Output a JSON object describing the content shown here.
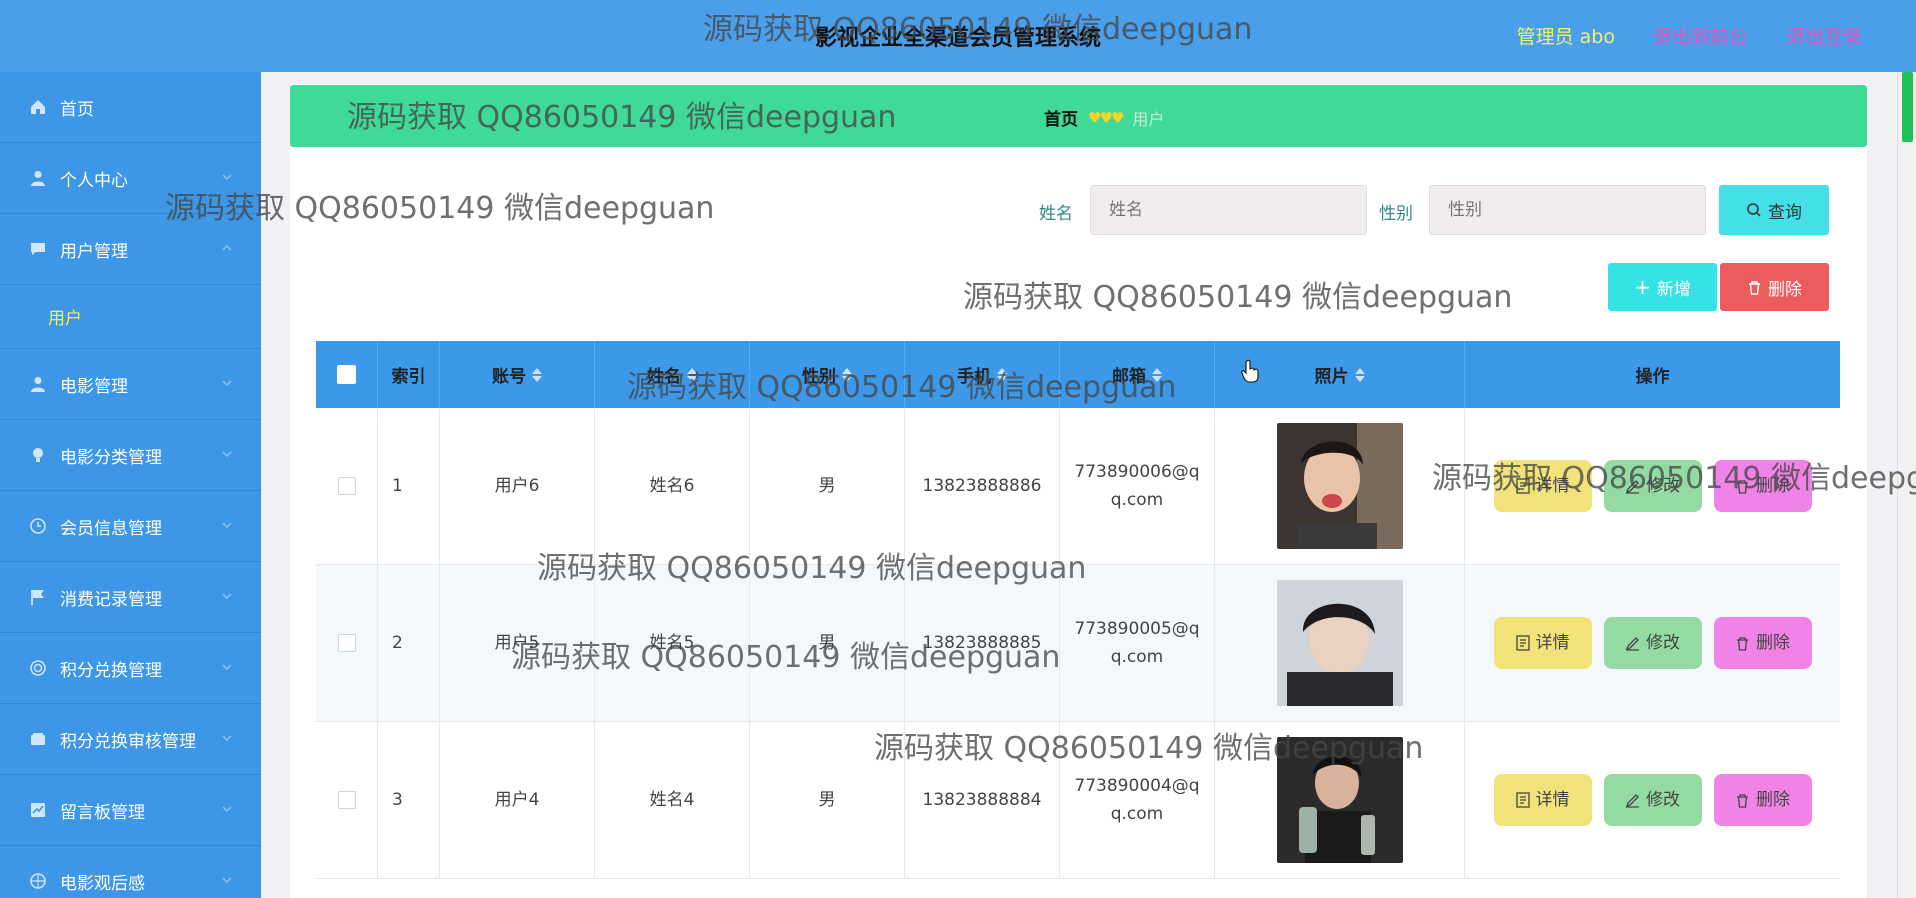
{
  "header": {
    "title": "影视企业全渠道会员管理系统",
    "admin_label": "管理员 abo",
    "back_front": "退出到前台",
    "logout": "退出登录"
  },
  "sidebar": {
    "items": [
      {
        "label": "首页",
        "icon": "home-icon"
      },
      {
        "label": "个人中心",
        "icon": "user-icon"
      },
      {
        "label": "用户管理",
        "icon": "chat-icon",
        "expanded": true
      },
      {
        "label": "电影管理",
        "icon": "user-icon"
      },
      {
        "label": "电影分类管理",
        "icon": "bulb-icon"
      },
      {
        "label": "会员信息管理",
        "icon": "clock-icon"
      },
      {
        "label": "消费记录管理",
        "icon": "flag-icon"
      },
      {
        "label": "积分兑换管理",
        "icon": "circle-icon"
      },
      {
        "label": "积分兑换审核管理",
        "icon": "wallet-icon"
      },
      {
        "label": "留言板管理",
        "icon": "chart-icon"
      },
      {
        "label": "电影观后感",
        "icon": "target-icon"
      }
    ],
    "sub_user": "用户"
  },
  "breadcrumb": {
    "home": "首页",
    "hearts": "♥♥♥",
    "current": "用户"
  },
  "search": {
    "name_label": "姓名",
    "name_placeholder": "姓名",
    "gender_label": "性别",
    "gender_placeholder": "性别",
    "query_label": "查询"
  },
  "actions": {
    "add_label": "新增",
    "delete_label": "删除"
  },
  "table": {
    "headers": [
      "索引",
      "账号",
      "姓名",
      "性别",
      "手机",
      "邮箱",
      "照片",
      "操作"
    ],
    "rows": [
      {
        "index": "1",
        "account": "用户6",
        "name": "姓名6",
        "gender": "男",
        "phone": "13823888886",
        "email": "773890006@qq.com"
      },
      {
        "index": "2",
        "account": "用户5",
        "name": "姓名5",
        "gender": "男",
        "phone": "13823888885",
        "email": "773890005@qq.com"
      },
      {
        "index": "3",
        "account": "用户4",
        "name": "姓名4",
        "gender": "男",
        "phone": "13823888884",
        "email": "773890004@qq.com"
      }
    ],
    "op_detail": "详情",
    "op_edit": "修改",
    "op_delete": "删除"
  },
  "watermark": "源码获取 QQ86050149 微信deepguan",
  "colors": {
    "header_bg": "#4a9fea",
    "sidebar_bg": "#3d97e6",
    "breadcrumb_bg": "#3fda98",
    "table_head_bg": "#3c98e8"
  }
}
